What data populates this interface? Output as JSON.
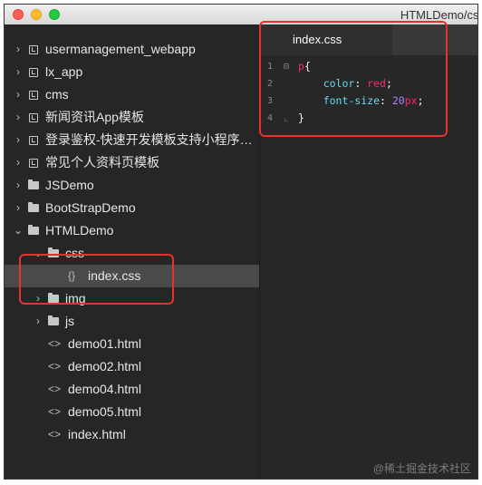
{
  "window": {
    "title": "HTMLDemo/css"
  },
  "sidebar": {
    "items": [
      {
        "label": "usermanagement_webapp",
        "kind": "project",
        "chevron": "›",
        "icon": "project-icon"
      },
      {
        "label": "lx_app",
        "kind": "project",
        "chevron": "›",
        "icon": "project-icon"
      },
      {
        "label": "cms",
        "kind": "project",
        "chevron": "›",
        "icon": "project-icon"
      },
      {
        "label": "新闻资讯App模板",
        "kind": "project",
        "chevron": "›",
        "icon": "project-icon"
      },
      {
        "label": "登录鉴权-快速开发模板支持小程序…",
        "kind": "project",
        "chevron": "›",
        "icon": "project-icon"
      },
      {
        "label": "常见个人资料页模板",
        "kind": "project",
        "chevron": "›",
        "icon": "project-icon"
      },
      {
        "label": "JSDemo",
        "kind": "folder",
        "chevron": "›",
        "icon": "folder-icon"
      },
      {
        "label": "BootStrapDemo",
        "kind": "folder",
        "chevron": "›",
        "icon": "folder-icon"
      },
      {
        "label": "HTMLDemo",
        "kind": "folder",
        "chevron": "⌄",
        "icon": "folder-icon"
      },
      {
        "label": "css",
        "kind": "folder",
        "chevron": "⌄",
        "icon": "folder-icon"
      },
      {
        "label": "index.css",
        "kind": "css-file",
        "icon_text": "{}"
      },
      {
        "label": "img",
        "kind": "folder",
        "chevron": "›",
        "icon": "folder-icon"
      },
      {
        "label": "js",
        "kind": "folder",
        "chevron": "›",
        "icon": "folder-icon"
      },
      {
        "label": "demo01.html",
        "kind": "html-file",
        "icon_text": "<>"
      },
      {
        "label": "demo02.html",
        "kind": "html-file",
        "icon_text": "<>"
      },
      {
        "label": "demo04.html",
        "kind": "html-file",
        "icon_text": "<>"
      },
      {
        "label": "demo05.html",
        "kind": "html-file",
        "icon_text": "<>"
      },
      {
        "label": "index.html",
        "kind": "html-file",
        "icon_text": "<>"
      }
    ],
    "selected_label": "index.css"
  },
  "editor": {
    "tab_label": "index.css",
    "lines": [
      {
        "num": "1",
        "fold": "⊟",
        "tokens": [
          {
            "t": "p",
            "c": "sel"
          },
          {
            "t": "{",
            "c": "brace"
          }
        ]
      },
      {
        "num": "2",
        "fold": "",
        "tokens": [
          {
            "t": "    color",
            "c": "prop"
          },
          {
            "t": ": ",
            "c": "punct"
          },
          {
            "t": "red",
            "c": "val"
          },
          {
            "t": ";",
            "c": "punct"
          }
        ]
      },
      {
        "num": "3",
        "fold": "",
        "tokens": [
          {
            "t": "    font-size",
            "c": "prop"
          },
          {
            "t": ": ",
            "c": "punct"
          },
          {
            "t": "20",
            "c": "num"
          },
          {
            "t": "px",
            "c": "unit"
          },
          {
            "t": ";",
            "c": "punct"
          }
        ]
      },
      {
        "num": "4",
        "fold": "⌞",
        "tokens": [
          {
            "t": "}",
            "c": "brace"
          }
        ]
      }
    ]
  },
  "watermark": "@稀土掘金技术社区",
  "colors": {
    "annotation": "#e5322d",
    "selected_row": "#4a4a4a",
    "background": "#262626"
  }
}
